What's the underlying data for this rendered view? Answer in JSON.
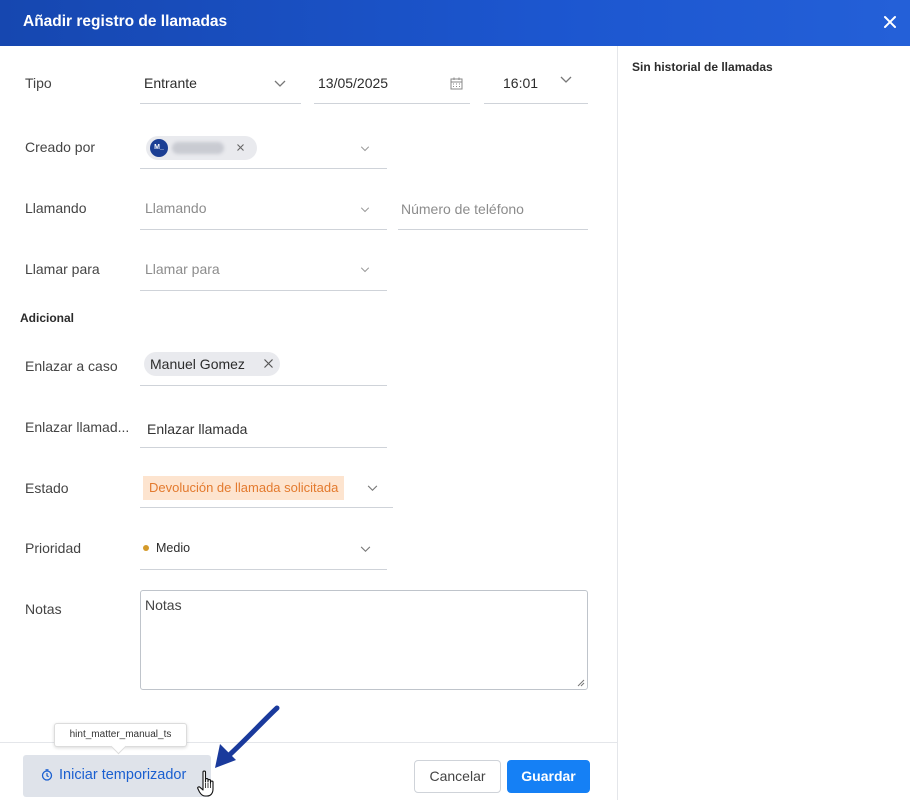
{
  "dialog": {
    "title": "Añadir registro de llamadas",
    "history_title": "Sin historial de llamadas"
  },
  "form": {
    "tipo": {
      "label": "Tipo",
      "value": "Entrante",
      "date": "13/05/2025",
      "time": "16:01"
    },
    "creado_por": {
      "label": "Creado por",
      "avatar_initials": "M_"
    },
    "llamando": {
      "label": "Llamando",
      "placeholder": "Llamando",
      "phone_placeholder": "Número de teléfono"
    },
    "llamar_para": {
      "label": "Llamar para",
      "placeholder": "Llamar para"
    },
    "section_additional": "Adicional",
    "enlazar_caso": {
      "label": "Enlazar a caso",
      "chip": "Manuel Gomez"
    },
    "enlazar_llamada": {
      "label": "Enlazar llamad...",
      "value": "Enlazar llamada"
    },
    "estado": {
      "label": "Estado",
      "value": "Devolución de llamada solicitada",
      "color": "#e37a2e"
    },
    "prioridad": {
      "label": "Prioridad",
      "value": "Medio",
      "dot_color": "#d49a2a"
    },
    "notas": {
      "label": "Notas",
      "placeholder": "Notas"
    }
  },
  "footer": {
    "timer_label": "Iniciar temporizador",
    "tooltip": "hint_matter_manual_ts",
    "cancel_label": "Cancelar",
    "save_label": "Guardar"
  },
  "colors": {
    "header": "#1c56cf",
    "primary": "#1580f5",
    "annotation_arrow": "#1a3a9c"
  }
}
